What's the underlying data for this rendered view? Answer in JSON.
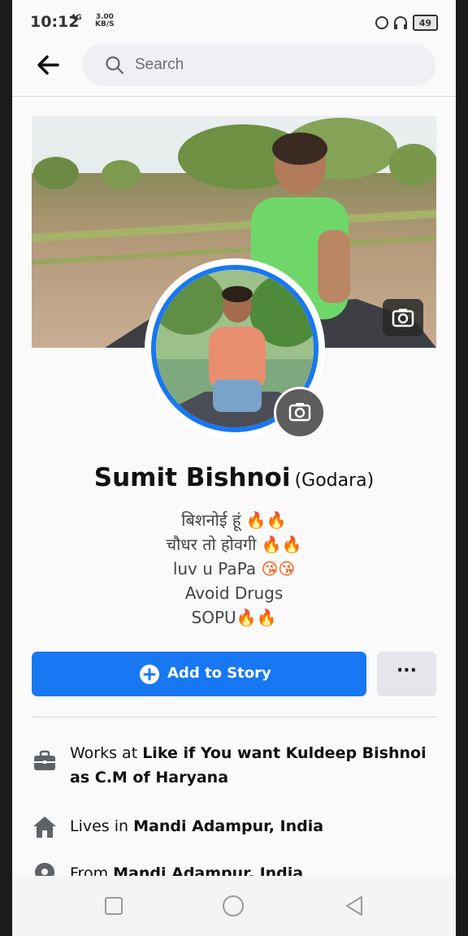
{
  "status": {
    "time": "10:12",
    "network": "4G",
    "speed_value": "3.00",
    "speed_unit": "KB/S",
    "battery": "49"
  },
  "topbar": {
    "search_placeholder": "Search"
  },
  "profile": {
    "name": "Sumit Bishnoi",
    "alt_name": "(Godara)",
    "bio": [
      {
        "text": "बिशनोई हूं",
        "emoji": "🔥🔥"
      },
      {
        "text": "चौधर तो होवगी",
        "emoji": "🔥🔥"
      },
      {
        "text": "luv u PaPa",
        "emoji": "😘😘"
      },
      {
        "text": "Avoid Drugs",
        "emoji": ""
      },
      {
        "text": "SOPU",
        "emoji": "🔥🔥"
      }
    ]
  },
  "actions": {
    "add_story": "Add to Story",
    "more": "···"
  },
  "details": {
    "work_prefix": "Works at",
    "work_place": "Like if You want Kuldeep Bishnoi as C.M of Haryana",
    "lives_prefix": "Lives in",
    "lives_place": "Mandi Adampur, India",
    "from_prefix": "From",
    "from_place": "Mandi Adampur, India"
  },
  "colors": {
    "brand_blue": "#1877f2",
    "more_button": "#e4e6eb"
  }
}
